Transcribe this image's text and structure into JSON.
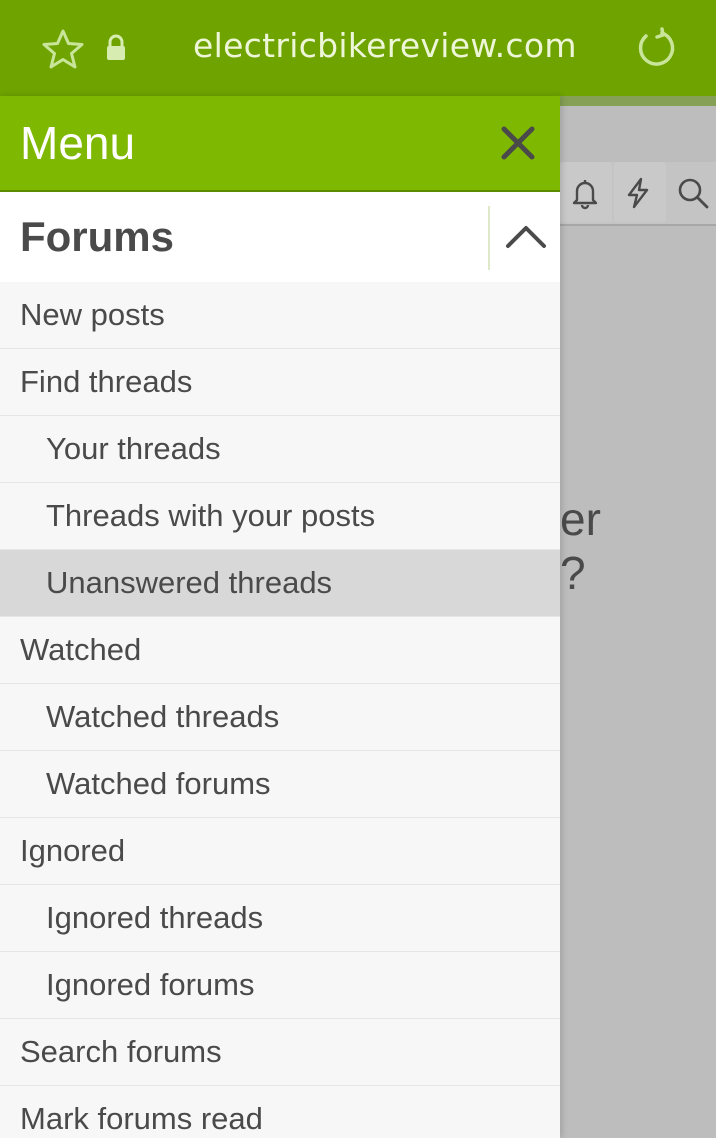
{
  "browser": {
    "url": "electricbikereview.com",
    "theme_color": "#6ea300"
  },
  "background_page": {
    "nav_icons": [
      "bell-icon",
      "lightning-icon",
      "search-icon"
    ],
    "partial_text_line1": "er",
    "partial_text_line2": "?"
  },
  "drawer": {
    "title": "Menu",
    "header_color": "#7fb800",
    "section": {
      "title": "Forums",
      "items": [
        {
          "label": "New posts",
          "level": 0
        },
        {
          "label": "Find threads",
          "level": 0
        },
        {
          "label": "Your threads",
          "level": 1
        },
        {
          "label": "Threads with your posts",
          "level": 1
        },
        {
          "label": "Unanswered threads",
          "level": 1,
          "active": true
        },
        {
          "label": "Watched",
          "level": 0
        },
        {
          "label": "Watched threads",
          "level": 1
        },
        {
          "label": "Watched forums",
          "level": 1
        },
        {
          "label": "Ignored",
          "level": 0
        },
        {
          "label": "Ignored threads",
          "level": 1
        },
        {
          "label": "Ignored forums",
          "level": 1
        },
        {
          "label": "Search forums",
          "level": 0
        },
        {
          "label": "Mark forums read",
          "level": 0
        }
      ]
    }
  }
}
